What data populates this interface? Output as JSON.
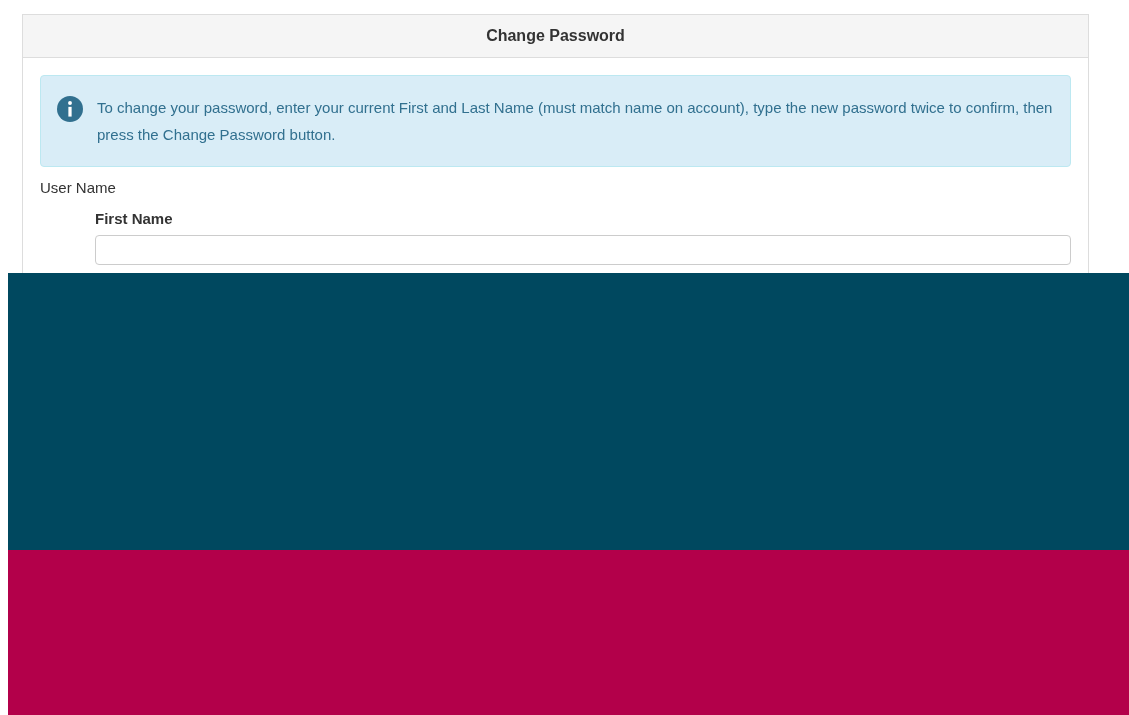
{
  "dialog": {
    "title": "Change Password"
  },
  "alert": {
    "text": "To change your password, enter your current First and Last Name (must match name on account), type the new password twice to confirm, then press the Change Password button."
  },
  "form": {
    "user_name_label": "User Name",
    "fields": [
      {
        "label": "First Name"
      }
    ]
  }
}
